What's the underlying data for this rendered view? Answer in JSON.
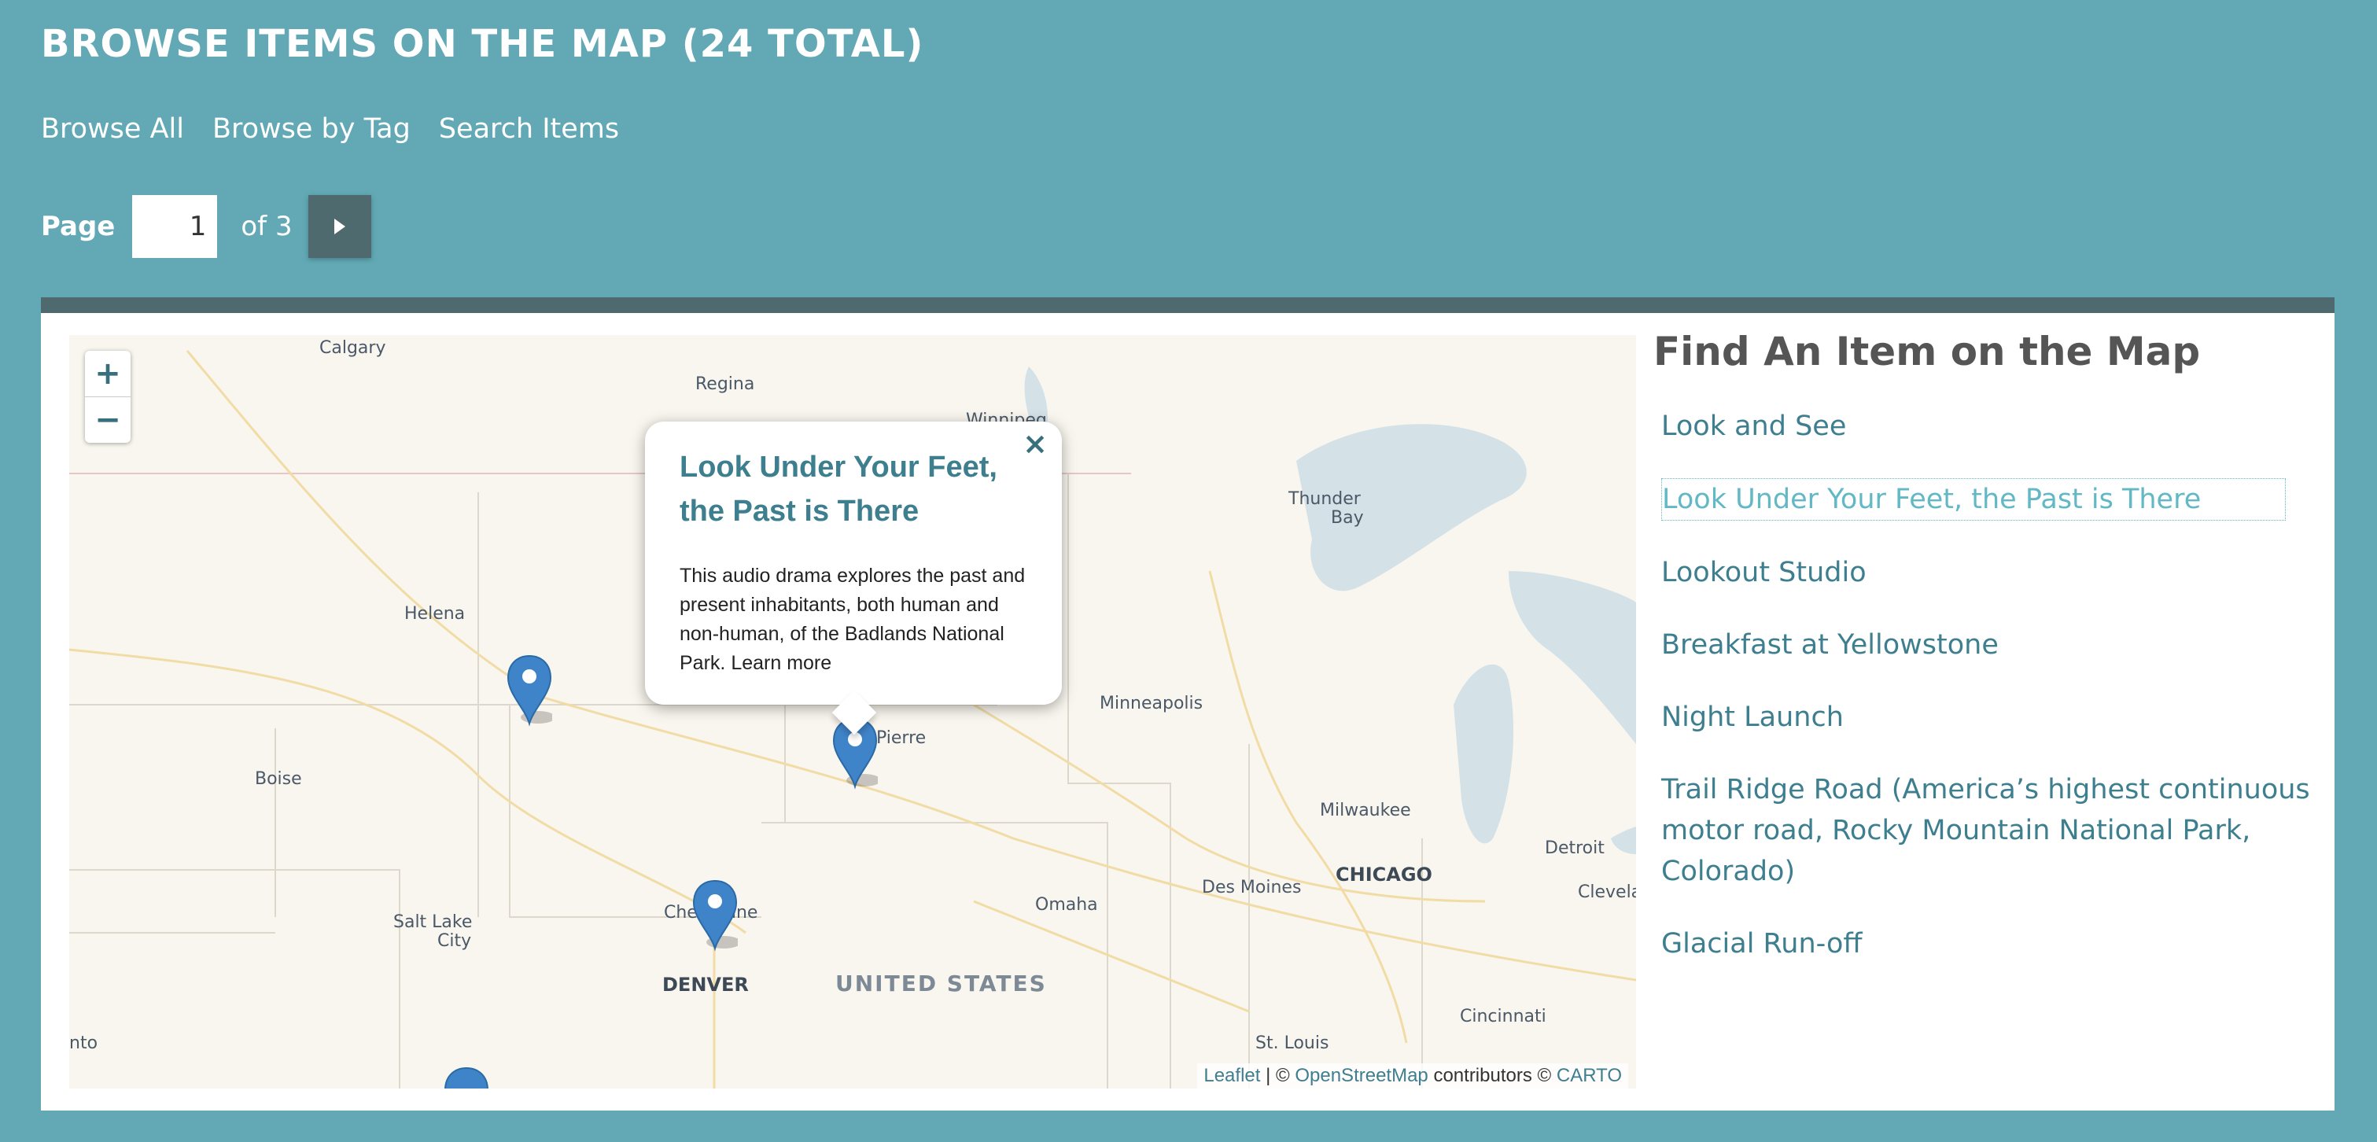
{
  "header": {
    "title": "BROWSE ITEMS ON THE MAP (24 TOTAL)",
    "nav": [
      "Browse All",
      "Browse by Tag",
      "Search Items"
    ]
  },
  "pagination": {
    "label": "Page",
    "current": "1",
    "of_label": "of 3",
    "next_icon": "play-right-icon"
  },
  "map": {
    "zoom_in": "+",
    "zoom_out": "−",
    "cities": [
      "Calgary",
      "Regina",
      "Winnipeg",
      "Thunder",
      "Bay",
      "Helena",
      "Boise",
      "Pierre",
      "Minneapolis",
      "Milwaukee",
      "Detroit",
      "Clevela",
      "CHICAGO",
      "Des Moines",
      "Omaha",
      "Salt Lake",
      "City",
      "Che",
      "nne",
      "DENVER",
      "UNITED STATES",
      "Cincinnati",
      "St. Louis",
      "nto"
    ],
    "popup": {
      "close": "×",
      "title": "Look Under Your Feet, the Past is There",
      "body": "This audio drama explores the past and present inhabitants, both human and non-human, of the Badlands National Park.",
      "link": "Learn more"
    },
    "attribution": {
      "leaflet": "Leaflet",
      "sep": " | © ",
      "osm": "OpenStreetMap",
      "contrib": " contributors © ",
      "carto": "CARTO"
    }
  },
  "sidebar": {
    "title": "Find An Item on the Map",
    "items": [
      "Look and See",
      "Look Under Your Feet, the Past is There",
      "Lookout Studio",
      "Breakfast at Yellowstone",
      "Night Launch",
      "Trail Ridge Road (America’s highest continuous motor road, Rocky Mountain National Park, Colorado)",
      "Glacial Run-off"
    ],
    "active_index": 1
  },
  "colors": {
    "background": "#62a9b5",
    "accent": "#3e7f8f",
    "dark_bar": "#4f6a6e",
    "active_link": "#62b8c4",
    "marker": "#3f83c8"
  }
}
